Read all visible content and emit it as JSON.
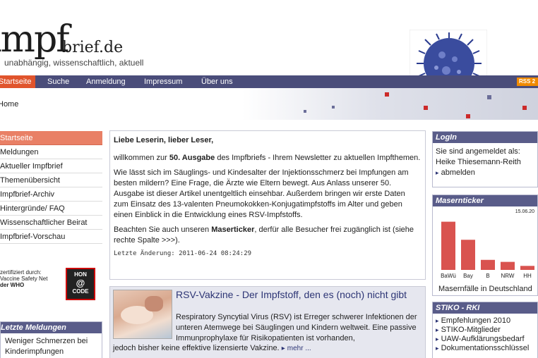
{
  "header": {
    "logo_impf": "impf",
    "logo_brief": "brief.de",
    "tagline": "unabhängig, wissenschaftlich, aktuell"
  },
  "nav": {
    "items": [
      "Startseite",
      "Suche",
      "Anmeldung",
      "Impressum",
      "Über uns"
    ],
    "rss": "RSS 2"
  },
  "breadcrumb": "Home",
  "sidebar": {
    "items": [
      "Startseite",
      "Meldungen",
      "Aktueller Impfbrief",
      "Themenübersicht",
      "Impfbrief-Archiv",
      "Hintergründe/ FAQ",
      "Wissenschaftlicher Beirat",
      "Impfbrief-Vorschau"
    ],
    "cert_line1": "zertifiziert durch:",
    "cert_line2": "Vaccine Safety Net",
    "cert_line3": "der WHO",
    "hon_line1": "HON",
    "hon_at": "@",
    "hon_line2": "CODE"
  },
  "latest_news": {
    "title": "Letzte Meldungen",
    "item_line1": "Weniger Schmerzen bei",
    "item_line2": "Kinderimpfungen"
  },
  "main": {
    "greeting": "Liebe Leserin, lieber Leser,",
    "p1_a": "willkommen zur ",
    "p1_b": "50. Ausgabe",
    "p1_c": " des Impfbriefs - Ihrem Newsletter zu aktuellen Impfthemen.",
    "p2": "Wie lässt sich im Säuglings- und Kindesalter der Injektionsschmerz bei Impfungen am besten mildern? Eine Frage, die Ärzte wie Eltern bewegt. Aus Anlass unserer 50. Ausgabe ist dieser Artikel unentgeltlich einsehbar. Außerdem bringen wir erste Daten zum Einsatz des 13-valenten Pneumokokken-Konjugatimpfstoffs im Alter und geben einen Einblick in die Entwicklung eines RSV-Impfstoffs.",
    "p3_a": "Beachten Sie auch unseren ",
    "p3_b": "Maserticker",
    "p3_c": ", derfür alle Besucher frei zugänglich ist (siehe rechte Spalte >>>).",
    "updated": "Letzte Änderung: 2011-06-24 08:24:29"
  },
  "article": {
    "title": "RSV-Vakzine - Der Impfstoff, den es (noch) nicht gibt",
    "text": "Respiratory Syncytial Virus (RSV) ist Erreger schwerer Infektionen der unteren Atemwege bei Säuglingen und Kindern weltweit. Eine passive Immunprophylaxe für Risikopatienten ist vorhanden,",
    "text2": "jedoch bisher keine effektive lizensierte Vakzine.",
    "more": "mehr ..."
  },
  "login": {
    "title": "LogIn",
    "line1": "Sie sind angemeldet als:",
    "user": "Heike Thiesemann-Reith",
    "logout": "abmelden"
  },
  "ticker": {
    "title": "Masernticker",
    "date": "15.06.20",
    "caption": "Masernfälle in Deutschland"
  },
  "chart_data": {
    "type": "bar",
    "categories": [
      "BaWü",
      "Bay",
      "B",
      "NRW",
      "HH"
    ],
    "values": [
      72,
      45,
      15,
      12,
      6
    ],
    "title": "",
    "ylim": [
      0,
      80
    ],
    "bar_color": "#d9534f"
  },
  "stiko": {
    "title": "STIKO - RKI",
    "items": [
      "Empfehlungen 2010",
      "STIKO-Mitglieder",
      "UAW-Aufklärungsbedarf",
      "Dokumentationsschlüssel"
    ]
  }
}
